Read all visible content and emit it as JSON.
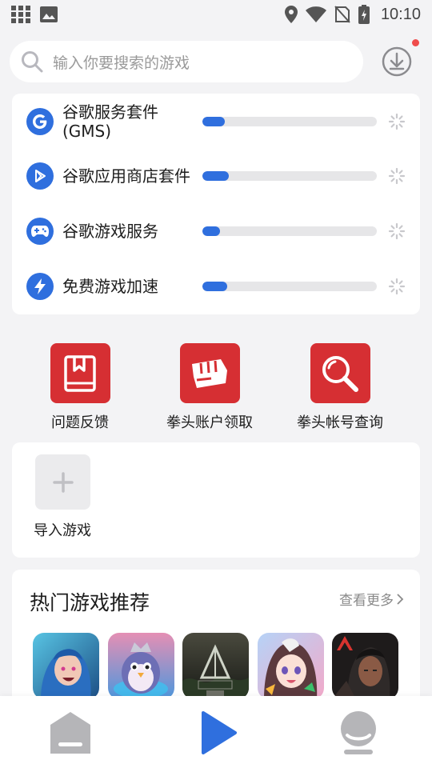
{
  "status_bar": {
    "time": "10:10",
    "icons_left": [
      "apps-grid-icon",
      "image-icon"
    ],
    "icons_right": [
      "location-icon",
      "wifi-icon",
      "no-sim-icon",
      "battery-charging-icon"
    ]
  },
  "search": {
    "placeholder": "输入你要搜索的游戏",
    "icon": "search-icon",
    "download_icon": "download-icon",
    "has_notification_dot": true
  },
  "services": [
    {
      "label": "谷歌服务套件(GMS)",
      "icon": "google-g-icon",
      "progress": 0.13
    },
    {
      "label": "谷歌应用商店套件",
      "icon": "play-store-icon",
      "progress": 0.15
    },
    {
      "label": "谷歌游戏服务",
      "icon": "gamepad-icon",
      "progress": 0.1
    },
    {
      "label": "免费游戏加速",
      "icon": "lightning-icon",
      "progress": 0.14
    }
  ],
  "tools": [
    {
      "label": "问题反馈",
      "icon": "bookmark-book-icon"
    },
    {
      "label": "拳头账户领取",
      "icon": "riot-fist-icon"
    },
    {
      "label": "拳头帐号查询",
      "icon": "magnifier-icon"
    }
  ],
  "import": {
    "label": "导入游戏",
    "icon": "plus-icon"
  },
  "hot_games": {
    "title": "热门游戏推荐",
    "more": "查看更多",
    "games": [
      {
        "name_icon": "game-jinx-icon",
        "color_a": "#2e6fa6",
        "color_b": "#58c4e3"
      },
      {
        "name_icon": "game-penguin-icon",
        "color_a": "#d86ca5",
        "color_b": "#5aa8e6"
      },
      {
        "name_icon": "game-ark-icon",
        "color_a": "#2b2e28",
        "color_b": "#6f6a52"
      },
      {
        "name_icon": "game-anime-icon",
        "color_a": "#f3b7d3",
        "color_b": "#9db7f0"
      },
      {
        "name_icon": "game-apex-icon",
        "color_a": "#1f1d1d",
        "color_b": "#6a3b36"
      }
    ]
  },
  "bottom_nav": [
    {
      "icon": "home-icon",
      "active": false
    },
    {
      "icon": "play-icon",
      "active": true
    },
    {
      "icon": "profile-icon",
      "active": false
    }
  ],
  "colors": {
    "accent_blue": "#2f6fde",
    "tool_red": "#d62f33",
    "background": "#f3f3f5"
  }
}
